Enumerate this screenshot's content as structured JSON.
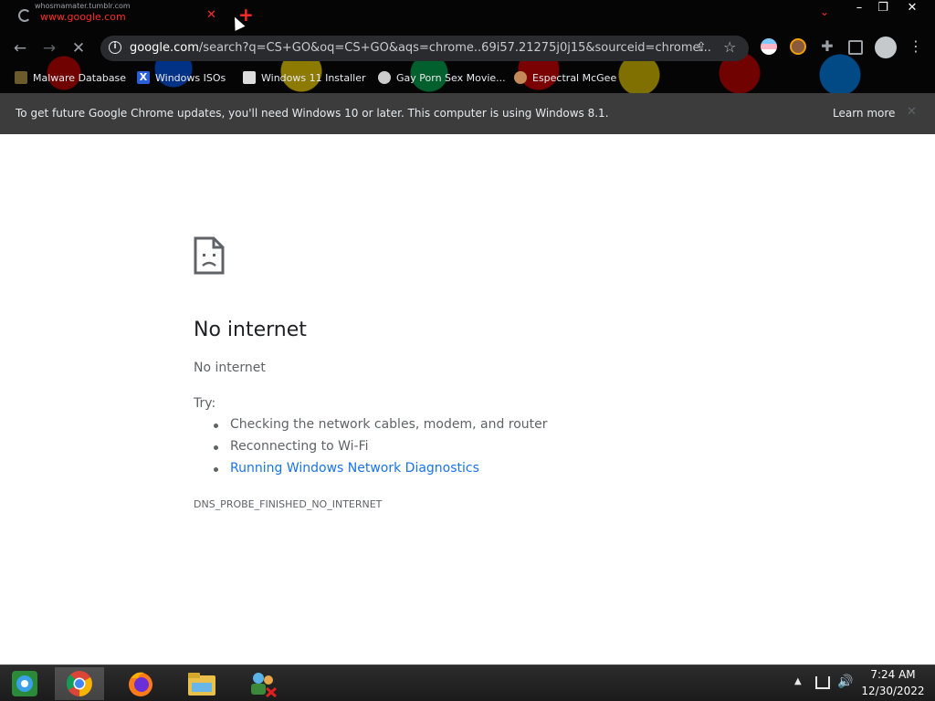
{
  "tab": {
    "subtitle": "whosmamater.tumblr.com",
    "title": "www.google.com",
    "close_glyph": "✕",
    "new_tab_glyph": "+"
  },
  "window_controls": {
    "minimize": "–",
    "maximize": "❐",
    "close": "✕"
  },
  "toolbar": {
    "back_glyph": "←",
    "forward_glyph": "→",
    "stop_glyph": "✕",
    "url_domain": "google.com",
    "url_rest": "/search?q=CS+GO&oq=CS+GO&aqs=chrome..69i57.21275j0j15&sourceid=chrome...",
    "share_glyph": "⇪",
    "star_glyph": "☆",
    "puzzle_glyph": "✚",
    "menu_glyph": "⋮"
  },
  "bookmarks": [
    {
      "label": "Malware Database",
      "icon": "bug-icon",
      "color": "#6b5a2a"
    },
    {
      "label": "Windows ISOs",
      "icon": "x-logo-icon",
      "color": "#2b5fd9"
    },
    {
      "label": "Windows 11 Installer",
      "icon": "document-icon",
      "color": "#dddddd"
    },
    {
      "label": "Gay Porn Sex Movie...",
      "icon": "favicon-icon",
      "color": "#cccccc"
    },
    {
      "label": "Espectral McGee",
      "icon": "avatar-icon",
      "color": "#c48a5a"
    }
  ],
  "infobar": {
    "message": "To get future Google Chrome updates, you'll need Windows 10 or later. This computer is using Windows 8.1.",
    "learn_more": "Learn more",
    "close_glyph": "✕"
  },
  "error_page": {
    "heading": "No internet",
    "subheading": "No internet",
    "try_label": "Try:",
    "suggestions": [
      "Checking the network cables, modem, and router",
      "Reconnecting to Wi-Fi",
      "Running Windows Network Diagnostics"
    ],
    "error_code": "DNS_PROBE_FINISHED_NO_INTERNET",
    "link_color": "#1a73e8"
  },
  "taskbar": {
    "apps": [
      "control-panel-icon",
      "chrome-icon",
      "firefox-icon",
      "file-explorer-icon",
      "network-icon"
    ],
    "tray_up_glyph": "▲",
    "volume_glyph": "🔊",
    "time": "7:24 AM",
    "date": "12/30/2022"
  }
}
